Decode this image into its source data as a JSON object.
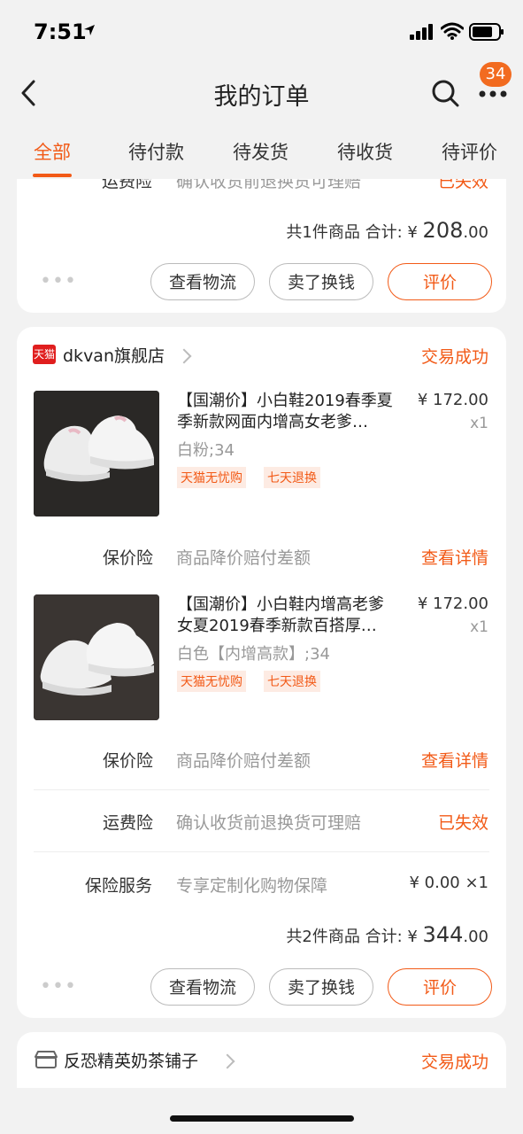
{
  "status_bar": {
    "time": "7:51"
  },
  "nav": {
    "title": "我的订单",
    "badge": "34"
  },
  "tabs": [
    {
      "label": "全部"
    },
    {
      "label": "待付款"
    },
    {
      "label": "待发货"
    },
    {
      "label": "待收货"
    },
    {
      "label": "待评价"
    }
  ],
  "colors": {
    "accent": "#f25a17",
    "tmall_red": "#e01e1e"
  },
  "order1": {
    "freight_label": "运费险",
    "freight_desc": "确认收货前退换货可理赔",
    "freight_status": "已失效",
    "summary_prefix": "共1件商品 合计: ¥ ",
    "total_int": "208",
    "total_dec": ".00",
    "buttons": {
      "logistics": "查看物流",
      "resell": "卖了换钱",
      "review": "评价"
    }
  },
  "order2": {
    "shop_logo": "天猫",
    "shop": "dkvan旗舰店",
    "status": "交易成功",
    "items": [
      {
        "title": "【国潮价】小白鞋2019春季夏季新款网面内增高女老爹…",
        "sku": "白粉;34",
        "price": "¥ 172.00",
        "qty": "x1",
        "tags": [
          "天猫无忧购",
          "七天退换"
        ],
        "protect_label": "保价险",
        "protect_desc": "商品降价赔付差额",
        "protect_link": "查看详情"
      },
      {
        "title": "【国潮价】小白鞋内增高老爹女夏2019春季新款百搭厚…",
        "sku": "白色【内增高款】;34",
        "price": "¥ 172.00",
        "qty": "x1",
        "tags": [
          "天猫无忧购",
          "七天退换"
        ],
        "protect_label": "保价险",
        "protect_desc": "商品降价赔付差额",
        "protect_link": "查看详情"
      }
    ],
    "freight_label": "运费险",
    "freight_desc": "确认收货前退换货可理赔",
    "freight_status": "已失效",
    "insurance_label": "保险服务",
    "insurance_desc": "专享定制化购物保障",
    "insurance_value": "¥ 0.00 ×1",
    "summary_prefix": "共2件商品 合计: ¥ ",
    "total_int": "344",
    "total_dec": ".00",
    "buttons": {
      "logistics": "查看物流",
      "resell": "卖了换钱",
      "review": "评价"
    }
  },
  "order3": {
    "shop": "反恐精英奶茶铺子",
    "status": "交易成功"
  }
}
